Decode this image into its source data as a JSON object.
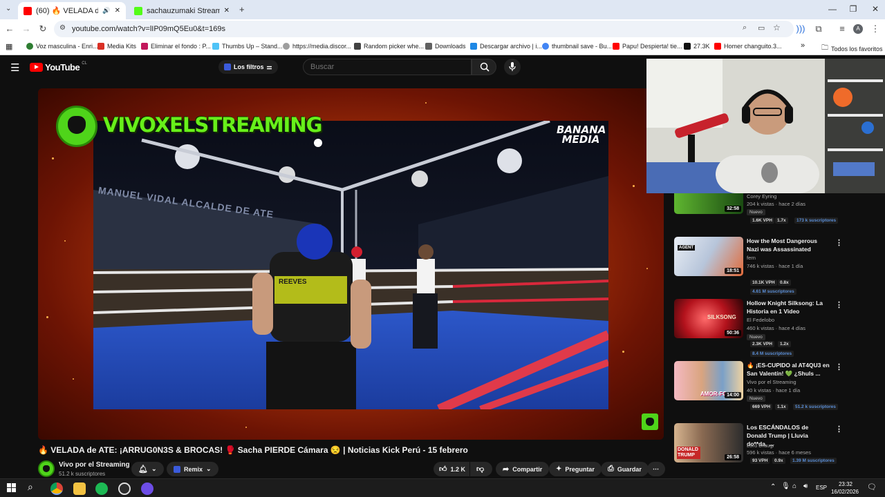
{
  "browser": {
    "tabs": [
      {
        "title": "(60) 🔥 VELADA de ATE: ¡AR",
        "active": true
      },
      {
        "title": "sachauzumaki Stream - Watch",
        "active": false
      }
    ],
    "url": "youtube.com/watch?v=lIP09mQ5Eu0&t=169s",
    "bookmarks": [
      "Voz masculina - Enri...",
      "Media Kits",
      "Eliminar el fondo : P...",
      "Thumbs Up – Stand...",
      "https://media.discor...",
      "Random picker whe...",
      "Downloads",
      "Descargar archivo | i...",
      "thumbnail save - Bu...",
      "Papu! Despierta! tie...",
      "27.3K",
      "Homer changuito.3...",
      "Todos los favoritos"
    ],
    "profile_initial": "A"
  },
  "youtube": {
    "logo": "YouTube",
    "region": "CL",
    "filters_label": "Los filtros",
    "search_placeholder": "Buscar"
  },
  "video": {
    "overlay_brand": "VIVOXELSTREAMING",
    "overlay_banana": "BANANA MEDIA",
    "ring_banner": "MANUEL VIDAL ALCALDE DE ATE",
    "shirt_text": "REEVES",
    "title": "🔥 VELADA de ATE: ¡ARRUG0N3S & BROCAS! 🥊 Sacha PIERDE Cámara 😒 | Noticias Kick Perú - 15 febrero",
    "channel": "Vivo por el Streaming",
    "subscribers": "51.2 k suscriptores",
    "actions": {
      "remix": "Remix",
      "likes": "1.2 K",
      "share": "Compartir",
      "ask": "Preguntar",
      "save": "Guardar"
    }
  },
  "recommendations": [
    {
      "title": "",
      "channel": "Corey Eyring",
      "meta": "204 k vistas · hace 2 días",
      "duration": "32:58",
      "badge": "Nuevo",
      "vph": "1.6K VPH",
      "mult": "1.7x",
      "subs": "173 k suscriptores"
    },
    {
      "title": "How the Most Dangerous Nazi was Assassinated",
      "channel": "fern",
      "meta": "746 k vistas · hace 1 día",
      "duration": "18:51",
      "badge": "",
      "vph": "10.1K VPH",
      "mult": "0.8x",
      "subs": "4.61 M suscriptores",
      "thumb_label": "AGENT"
    },
    {
      "title": "Hollow Knight Silksong: La Historia en 1 Video",
      "channel": "El Fedelobo",
      "meta": "460 k vistas · hace 4 días",
      "duration": "50:36",
      "badge": "Nuevo",
      "vph": "2.3K VPH",
      "mult": "1.2x",
      "subs": "8.4 M suscriptores",
      "thumb_label": "SILKSONG"
    },
    {
      "title": "🔥 ¡ES-CUPIDO al AT4QU3 en San Valentín! 💚 ¿Shuls ...",
      "channel": "Vivo por el Streaming",
      "meta": "40 k vistas · hace 1 día",
      "duration": "14:00",
      "badge": "Nuevo",
      "vph": "669 VPH",
      "mult": "1.1x",
      "subs": "51.2 k suscriptores",
      "thumb_label": "AMOR-FO"
    },
    {
      "title": "Los ESCÁNDALOS de Donald Trump | Lluvia do**da, ...",
      "channel": "Lord Draugr",
      "meta": "596 k vistas · hace 6 meses",
      "duration": "26:58",
      "badge": "",
      "vph": "93 VPH",
      "mult": "0.9x",
      "subs": "1.39 M suscriptores",
      "thumb_label": "DONALD TRUMP"
    }
  ],
  "taskbar": {
    "language": "ESP",
    "time": "23:32",
    "date": "16/02/2026"
  }
}
